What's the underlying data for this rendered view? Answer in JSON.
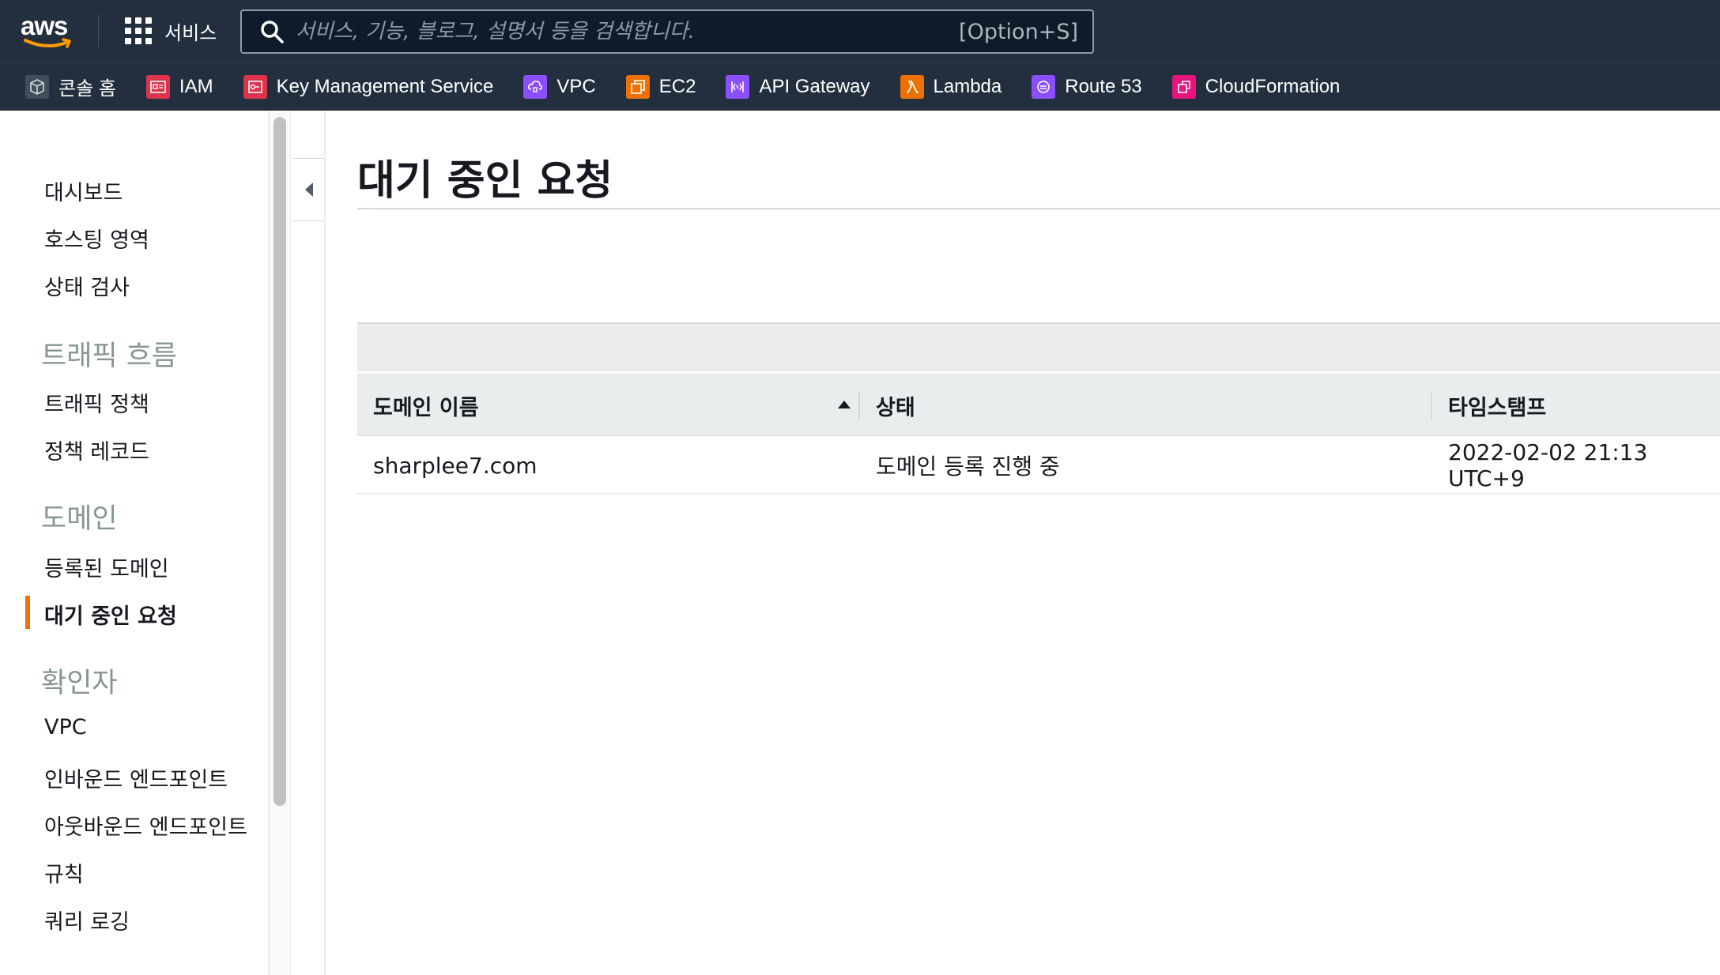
{
  "topnav": {
    "logo_text": "aws",
    "services_label": "서비스",
    "search_placeholder": "서비스, 기능, 블로그, 설명서 등을 검색합니다.",
    "search_shortcut": "[Option+S]"
  },
  "favorites": [
    {
      "label": "콘솔 홈",
      "icon": "cube-icon",
      "color": "#232f3e"
    },
    {
      "label": "IAM",
      "icon": "iam-icon",
      "color": "#dd344c"
    },
    {
      "label": "Key Management Service",
      "icon": "kms-icon",
      "color": "#dd344c"
    },
    {
      "label": "VPC",
      "icon": "vpc-icon",
      "color": "#8c4fff"
    },
    {
      "label": "EC2",
      "icon": "ec2-icon",
      "color": "#ed7100"
    },
    {
      "label": "API Gateway",
      "icon": "api-gateway-icon",
      "color": "#8c4fff"
    },
    {
      "label": "Lambda",
      "icon": "lambda-icon",
      "color": "#ed7100"
    },
    {
      "label": "Route 53",
      "icon": "route53-icon",
      "color": "#8c4fff"
    },
    {
      "label": "CloudFormation",
      "icon": "cloudformation-icon",
      "color": "#e7157b"
    }
  ],
  "sidebar": {
    "items": [
      {
        "label": "대시보드"
      },
      {
        "label": "호스팅 영역"
      },
      {
        "label": "상태 검사"
      }
    ],
    "sections": [
      {
        "title": "트래픽 흐름",
        "items": [
          "트래픽 정책",
          "정책 레코드"
        ]
      },
      {
        "title": "도메인",
        "items": [
          "등록된 도메인",
          "대기 중인 요청"
        ]
      },
      {
        "title": "확인자",
        "items": [
          "VPC",
          "인바운드 엔드포인트",
          "아웃바운드 엔드포인트",
          "규칙",
          "쿼리 로깅"
        ]
      }
    ],
    "active_item": "대기 중인 요청"
  },
  "main": {
    "title": "대기 중인 요청",
    "table": {
      "columns": [
        "도메인 이름",
        "상태",
        "타임스탬프"
      ],
      "sort_column": "도메인 이름",
      "rows": [
        {
          "domain": "sharplee7.com",
          "status": "도메인 등록 진행 중",
          "timestamp": "2022-02-02 21:13 UTC+9"
        }
      ]
    }
  },
  "colors": {
    "nav_bg": "#232f3e",
    "accent": "#ec7211"
  }
}
